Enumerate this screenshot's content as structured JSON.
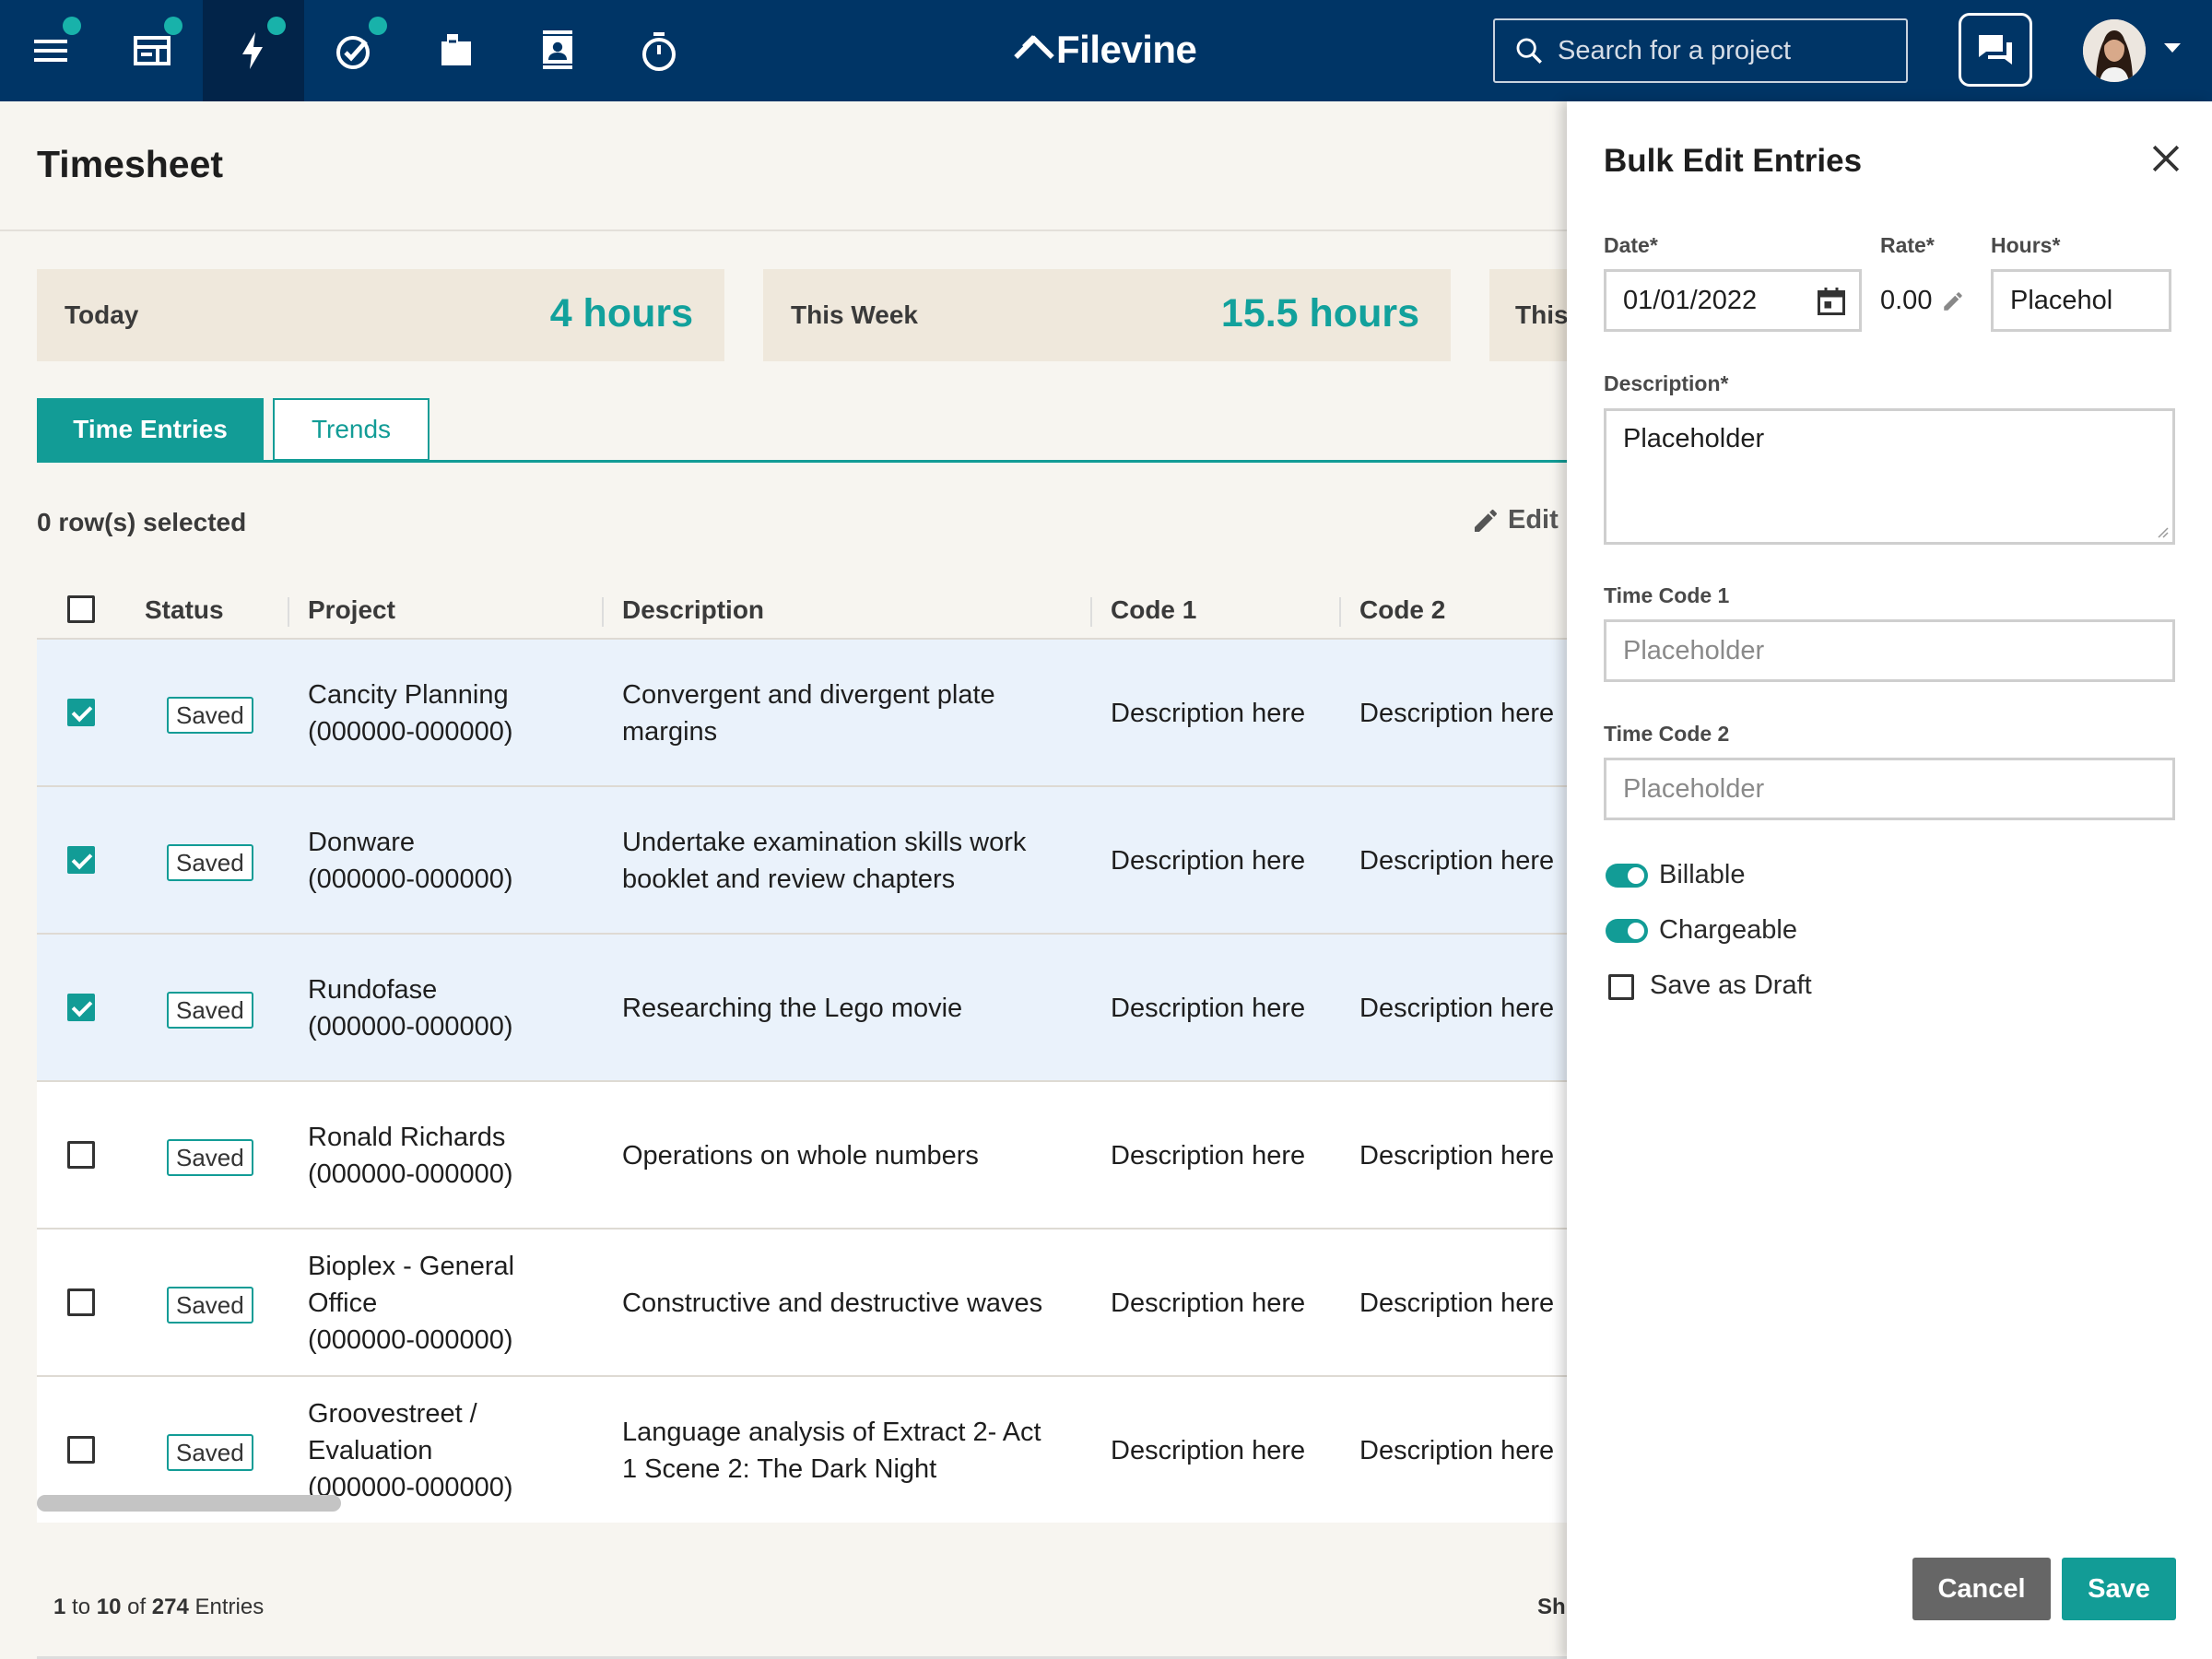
{
  "topbar": {
    "logo": "Filevine",
    "search_placeholder": "Search for a project",
    "nav_icons": [
      "menu-icon",
      "dashboard-icon",
      "activity-icon",
      "tasks-icon",
      "documents-icon",
      "contacts-icon",
      "timer-icon"
    ]
  },
  "page": {
    "title": "Timesheet",
    "stats": [
      {
        "label": "Today",
        "value": "4 hours"
      },
      {
        "label": "This Week",
        "value": "15.5 hours"
      },
      {
        "label": "This",
        "value": ""
      }
    ],
    "tabs": {
      "active": "Time Entries",
      "inactive": "Trends"
    },
    "selected_count": "0 row(s) selected",
    "edit_label": "Edit"
  },
  "table": {
    "headers": {
      "status": "Status",
      "project": "Project",
      "description": "Description",
      "code1": "Code 1",
      "code2": "Code 2"
    },
    "rows": [
      {
        "checked": true,
        "status": "Saved",
        "project": [
          "Cancity Planning",
          "(000000-000000)"
        ],
        "description": [
          "Convergent and divergent plate",
          "margins"
        ],
        "code1": "Description here",
        "code2": "Description here"
      },
      {
        "checked": true,
        "status": "Saved",
        "project": [
          "Donware",
          "(000000-000000)"
        ],
        "description": [
          "Undertake examination skills work",
          "booklet and review chapters"
        ],
        "code1": "Description here",
        "code2": "Description here"
      },
      {
        "checked": true,
        "status": "Saved",
        "project": [
          "Rundofase",
          "(000000-000000)"
        ],
        "description": [
          "Researching the Lego movie"
        ],
        "code1": "Description here",
        "code2": "Description here"
      },
      {
        "checked": false,
        "status": "Saved",
        "project": [
          "Ronald Richards",
          "(000000-000000)"
        ],
        "description": [
          "Operations on whole numbers"
        ],
        "code1": "Description here",
        "code2": "Description here"
      },
      {
        "checked": false,
        "status": "Saved",
        "project": [
          "Bioplex - General",
          "Office",
          "(000000-000000)"
        ],
        "description": [
          "Constructive and destructive waves"
        ],
        "code1": "Description here",
        "code2": "Description here"
      },
      {
        "checked": false,
        "status": "Saved",
        "project": [
          "Groovestreet /",
          "Evaluation",
          "(000000-000000)"
        ],
        "description": [
          "Language analysis of Extract 2- Act",
          "1 Scene 2: The Dark Night"
        ],
        "code1": "Description here",
        "code2": "Description here"
      }
    ]
  },
  "footer": {
    "from": "1",
    "to": "10",
    "total": "274",
    "label": "Entries",
    "show_cut": "Sh"
  },
  "drawer": {
    "title": "Bulk Edit Entries",
    "date_label": "Date",
    "date_value": "01/01/2022",
    "rate_label": "Rate",
    "rate_value": "0.00",
    "hours_label": "Hours",
    "hours_value": "Placehol",
    "description_label": "Description",
    "description_value": "Placeholder",
    "time_code1_label": "Time Code 1",
    "time_code1_placeholder": "Placeholder",
    "time_code2_label": "Time Code 2",
    "time_code2_placeholder": "Placeholder",
    "billable_label": "Billable",
    "billable_on": true,
    "chargeable_label": "Chargeable",
    "chargeable_on": true,
    "draft_label": "Save as Draft",
    "draft_checked": false,
    "cancel_label": "Cancel",
    "save_label": "Save"
  },
  "colors": {
    "navy": "#003566",
    "teal": "#129c96",
    "selected_row": "#eaf2fb"
  }
}
